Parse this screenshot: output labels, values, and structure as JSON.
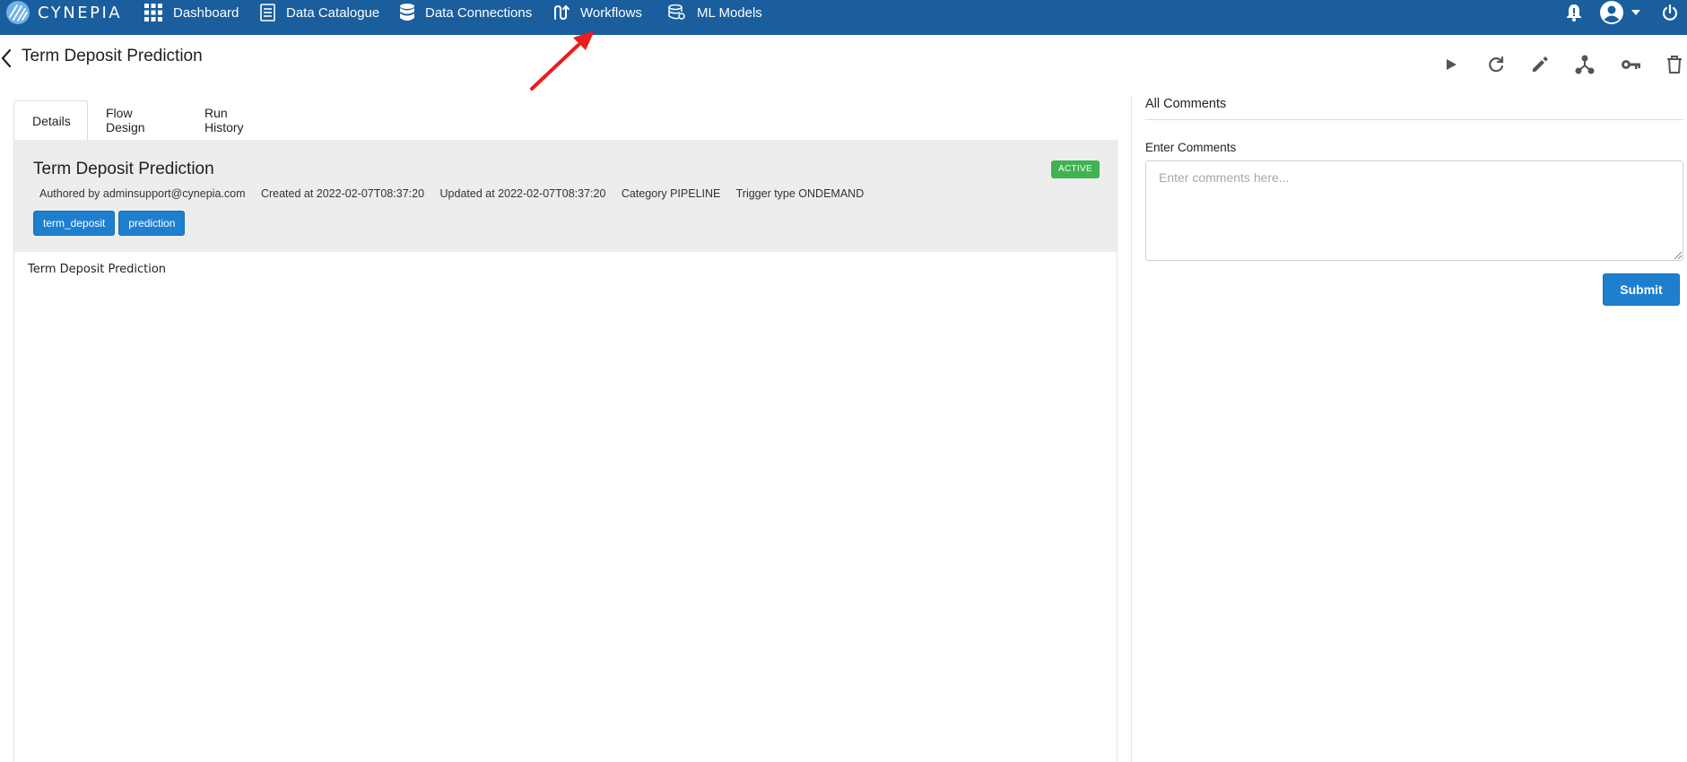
{
  "navbar": {
    "brand": "CYNEPIA",
    "items": [
      {
        "label": "Dashboard",
        "icon": "grid-icon"
      },
      {
        "label": "Data Catalogue",
        "icon": "document-icon"
      },
      {
        "label": "Data Connections",
        "icon": "database-icon"
      },
      {
        "label": "Workflows",
        "icon": "workflow-icon"
      },
      {
        "label": "ML Models",
        "icon": "ml-models-icon"
      }
    ],
    "right_icons": [
      "bell-icon",
      "user-avatar-icon",
      "caret-down-icon",
      "power-icon"
    ],
    "background_color": "#1a5e9e"
  },
  "header": {
    "title": "Term Deposit Prediction",
    "actions": [
      "play-icon",
      "refresh-icon",
      "edit-icon",
      "share-icon",
      "key-icon",
      "trash-icon"
    ]
  },
  "tabs": [
    {
      "label": "Details",
      "active": true
    },
    {
      "label": "Flow Design",
      "active": false
    },
    {
      "label": "Run History",
      "active": false
    }
  ],
  "details": {
    "title": "Term Deposit Prediction",
    "status": "ACTIVE",
    "status_color": "#3fb34f",
    "authored": "Authored by adminsupport@cynepia.com",
    "created": "Created at 2022-02-07T08:37:20",
    "updated": "Updated at 2022-02-07T08:37:20",
    "category": "Category PIPELINE",
    "trigger": "Trigger type ONDEMAND",
    "tags": [
      "term_deposit",
      "prediction"
    ],
    "description": "Term Deposit Prediction"
  },
  "comments": {
    "title": "All Comments",
    "label": "Enter Comments",
    "placeholder": "Enter comments here...",
    "submit_label": "Submit",
    "button_color": "#1f7fcf"
  }
}
